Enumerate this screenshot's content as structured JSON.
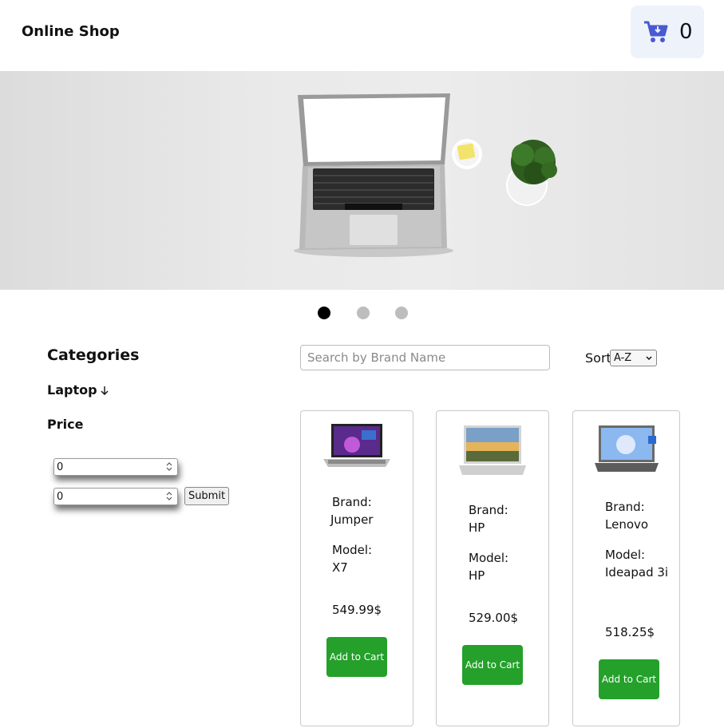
{
  "header": {
    "title": "Online Shop",
    "cart_count": "0"
  },
  "carousel": {
    "active_index": 0,
    "dot_count": 3
  },
  "sidebar": {
    "title": "Categories",
    "category": "Laptop",
    "price_title": "Price",
    "min_value": "0",
    "max_value": "0",
    "submit_label": "Submit"
  },
  "toolbar": {
    "search_placeholder": "Search by Brand Name",
    "sort_label": "Sort",
    "sort_value": "A-Z"
  },
  "products": [
    {
      "brand_label": "Brand:",
      "brand": "Jumper",
      "model_label": "Model:",
      "model": "X7",
      "price": "549.99$",
      "button": "Add to Cart"
    },
    {
      "brand_label": "Brand:",
      "brand": "HP",
      "model_label": "Model:",
      "model": "HP",
      "price": "529.00$",
      "button": "Add to Cart"
    },
    {
      "brand_label": "Brand:",
      "brand": "Lenovo",
      "model_label": "Model:",
      "model": "Ideapad 3i",
      "price": "518.25$",
      "button": "Add to Cart"
    }
  ],
  "colors": {
    "accent": "#24a02b",
    "cart_icon": "#4a5ad0",
    "cart_bg": "#eef3fb"
  }
}
